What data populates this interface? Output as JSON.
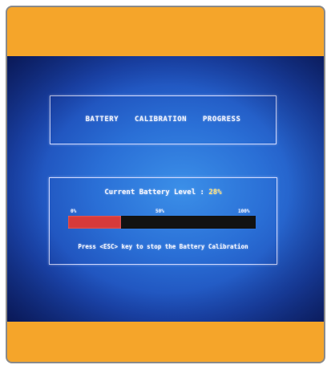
{
  "screen": {
    "title": "BATTERY CALIBRATION PROGRESS",
    "level_label": "Current Battery Level :",
    "level_value": "28%",
    "ticks": {
      "start": "0%",
      "mid": "50%",
      "end": "100%"
    },
    "progress_fraction": 0.28,
    "instruction": "Press <ESC> key to stop the Battery Calibration"
  },
  "colors": {
    "frame_accent": "#f5a52a",
    "screen_blue": "#2a6fd6",
    "progress_fill": "#d63a3a",
    "progress_track": "#121212"
  }
}
